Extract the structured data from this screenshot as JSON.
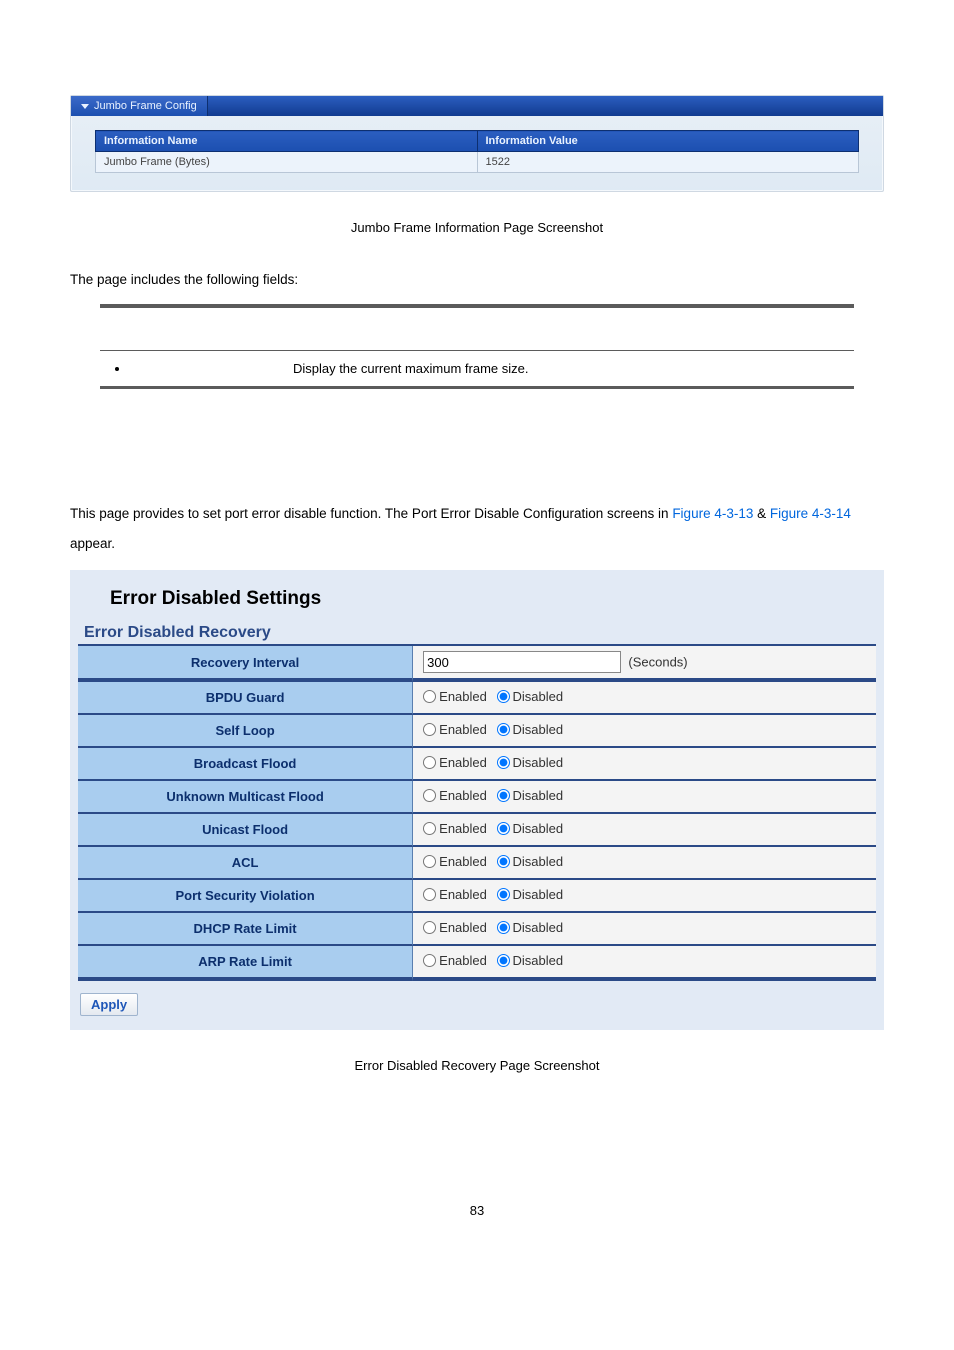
{
  "jumbo_panel": {
    "tab": "Jumbo Frame Config",
    "col1": "Information Name",
    "col2": "Information Value",
    "row_name": "Jumbo Frame (Bytes)",
    "row_value": "1522"
  },
  "caption1": "Jumbo Frame Information Page Screenshot",
  "intro_fields": "The page includes the following fields:",
  "fields_table": {
    "row_desc": "Display the current maximum frame size."
  },
  "para": {
    "t1": "This page provides to set port error disable function. The Port Error Disable Configuration screens in ",
    "link1": "Figure 4-3-13",
    "t2": " & ",
    "link2": "Figure 4-3-14",
    "t3": " appear."
  },
  "error_disabled": {
    "title": "Error Disabled Settings",
    "subtitle": "Error Disabled Recovery",
    "recovery_interval_label": "Recovery Interval",
    "recovery_interval_value": "300",
    "seconds": "(Seconds)",
    "enabled": "Enabled",
    "disabled": "Disabled",
    "rows": [
      {
        "label": "BPDU Guard"
      },
      {
        "label": "Self Loop"
      },
      {
        "label": "Broadcast Flood"
      },
      {
        "label": "Unknown Multicast Flood"
      },
      {
        "label": "Unicast Flood"
      },
      {
        "label": "ACL"
      },
      {
        "label": "Port Security Violation"
      },
      {
        "label": "DHCP Rate Limit"
      },
      {
        "label": "ARP Rate Limit"
      }
    ],
    "apply": "Apply"
  },
  "caption2": "Error Disabled Recovery Page Screenshot",
  "page_num": "83"
}
